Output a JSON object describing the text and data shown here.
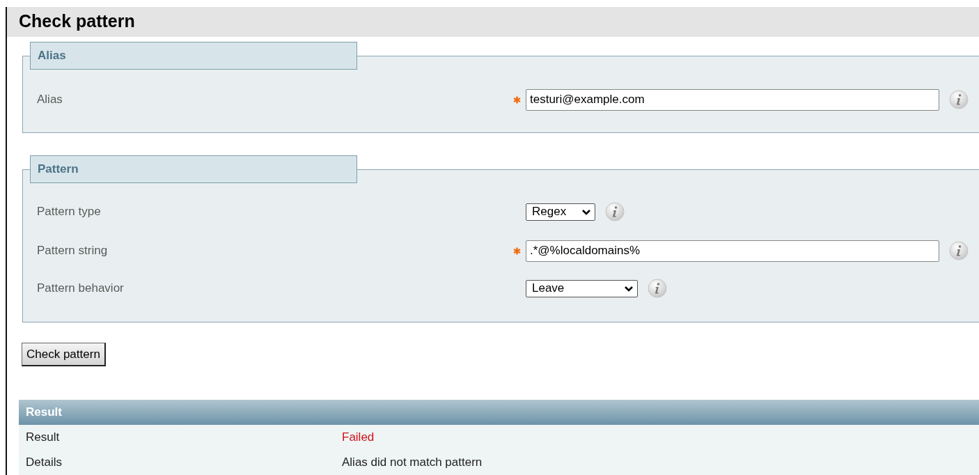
{
  "title": "Check pattern",
  "sections": [
    {
      "legend": "Alias",
      "fields": [
        {
          "kind": "text",
          "label": "Alias",
          "required": true,
          "value": "testuri@example.com"
        }
      ]
    },
    {
      "legend": "Pattern",
      "fields": [
        {
          "kind": "select",
          "label": "Pattern type",
          "required": false,
          "value": "Regex"
        },
        {
          "kind": "text",
          "label": "Pattern string",
          "required": true,
          "value": ".*@%localdomains%"
        },
        {
          "kind": "select",
          "label": "Pattern behavior",
          "required": false,
          "value": "Leave"
        }
      ]
    }
  ],
  "button": "Check pattern",
  "result": {
    "heading": "Result",
    "rows": [
      {
        "label": "Result",
        "value": "Failed",
        "failed": true
      },
      {
        "label": "Details",
        "value": "Alias did not match pattern",
        "failed": false
      }
    ]
  }
}
